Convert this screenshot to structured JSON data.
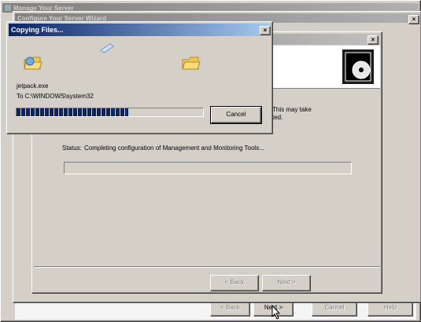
{
  "background": {
    "title": "Manage Your Server",
    "buttons": {
      "back": "< Back",
      "next": "Next >",
      "cancel": "Cancel",
      "help": "Help"
    }
  },
  "wizard": {
    "title": "Configure Your Server Wizard",
    "partial_text_1": "This may take",
    "partial_text_2": "ted.",
    "status_label": "Status:",
    "status_text": "Completing configuration of Management and Monitoring Tools...",
    "buttons": {
      "back": "< Back",
      "next": "Next >"
    }
  },
  "copy_dialog": {
    "title": "Copying Files...",
    "filename": "jetpack.exe",
    "destination": "To C:\\WINDOWS\\system32",
    "progress": 0.6,
    "cancel": "Cancel"
  }
}
